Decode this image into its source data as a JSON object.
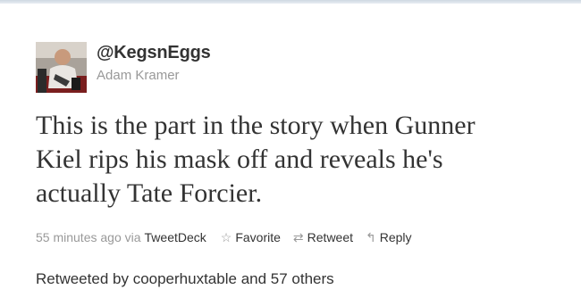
{
  "tweet": {
    "screen_name": "@KegsnEggs",
    "full_name": "Adam Kramer",
    "text": "This is the part in the story when Gunner Kiel rips his mask off and reveals he's actually Tate Forcier.",
    "text_lines": [
      "This is the part in the story when Gunner",
      "Kiel rips his mask off and reveals he's",
      "actually Tate Forcier."
    ],
    "timestamp": "55 minutes ago",
    "via_label": "via",
    "client": "TweetDeck"
  },
  "actions": {
    "favorite_label": "Favorite",
    "favorite_icon": "star-icon",
    "retweet_label": "Retweet",
    "retweet_icon": "retweet-icon",
    "reply_label": "Reply",
    "reply_icon": "reply-icon"
  },
  "retweeted": {
    "prefix": "Retweeted by",
    "user": "cooperhuxtable",
    "suffix": "and 57 others"
  },
  "colors": {
    "text": "#333333",
    "muted": "#999999",
    "background": "#ffffff"
  }
}
